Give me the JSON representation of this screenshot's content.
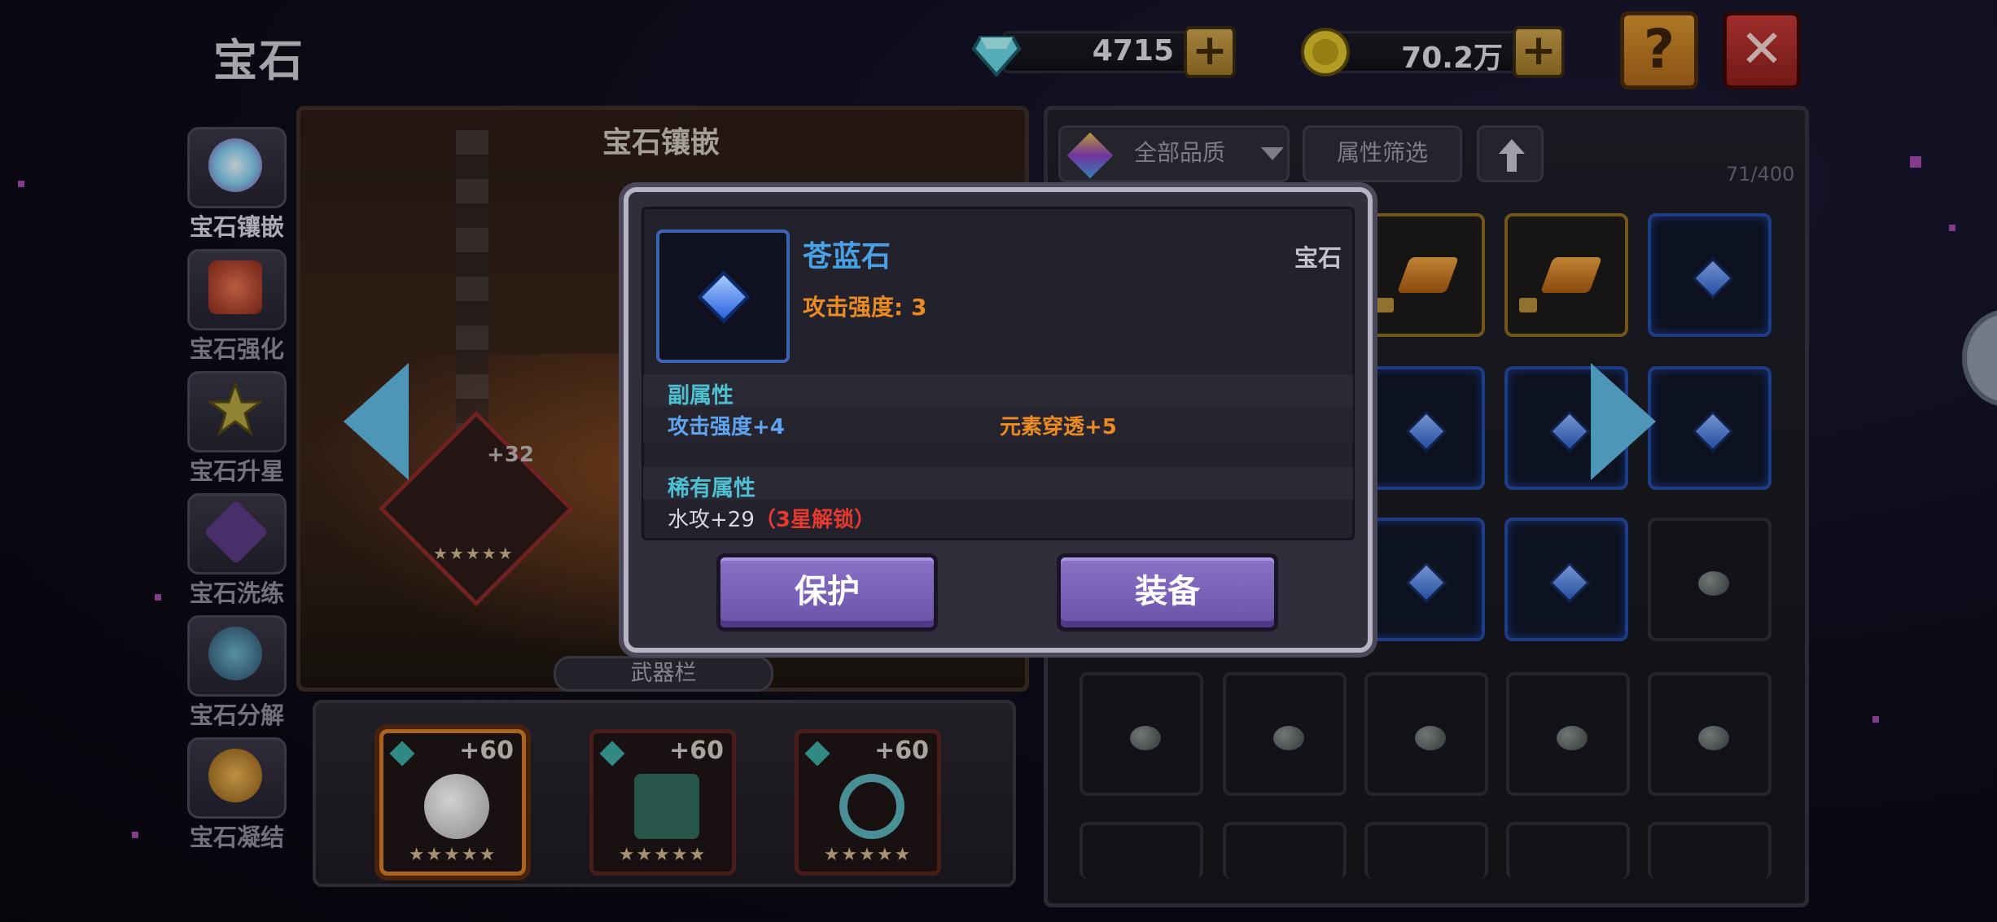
{
  "header": {
    "title": "宝石"
  },
  "currency": {
    "diamonds": {
      "icon": "diamond-icon",
      "amount": "4715",
      "plus": "+"
    },
    "coins": {
      "icon": "coin-icon",
      "amount": "70.2万",
      "plus": "+"
    }
  },
  "top_buttons": {
    "help": "?",
    "close": "✕"
  },
  "sidebar": {
    "items": [
      {
        "label": "宝石镶嵌",
        "icon": "gem-inlay-icon",
        "color": "#7ec8e8"
      },
      {
        "label": "宝石强化",
        "icon": "gem-enhance-icon",
        "color": "#c0402a"
      },
      {
        "label": "宝石升星",
        "icon": "star-icon",
        "color": "#d8c040"
      },
      {
        "label": "宝石洗练",
        "icon": "gem-refine-icon",
        "color": "#7a4ab0"
      },
      {
        "label": "宝石分解",
        "icon": "gem-decompose-icon",
        "color": "#4a90b0"
      },
      {
        "label": "宝石凝结",
        "icon": "gem-condense-icon",
        "color": "#d09a30"
      }
    ]
  },
  "center": {
    "title": "宝石镶嵌",
    "weapon_level": "+32",
    "weapon_bar_label": "武器栏",
    "weapons": [
      {
        "level": "+60",
        "stars": "★★★★★",
        "icon": "round-stone-icon"
      },
      {
        "level": "+60",
        "stars": "★★★★★",
        "icon": "helmet-icon"
      },
      {
        "level": "+60",
        "stars": "★★★★★",
        "icon": "swirl-icon"
      }
    ],
    "mini_stars": "★★★★★"
  },
  "inventory": {
    "quality_filter": "全部品质",
    "attribute_filter": "属性筛选",
    "sort_icon": "arrow-up-icon",
    "count": "71/400"
  },
  "popup": {
    "item_name": "苍蓝石",
    "item_type": "宝石",
    "main_stat": "攻击强度: 3",
    "sub_header": "副属性",
    "sub_stats": [
      "攻击强度+4",
      "元素穿透+5"
    ],
    "rare_header": "稀有属性",
    "rare_stat": "水攻+29",
    "rare_lock": "（3星解锁）",
    "buttons": {
      "protect": "保护",
      "equip": "装备"
    }
  },
  "colors": {
    "accent_blue": "#4aa0e4",
    "accent_orange": "#e98a22",
    "button_purple": "#7a62b8",
    "lock_red": "#e63a30"
  }
}
